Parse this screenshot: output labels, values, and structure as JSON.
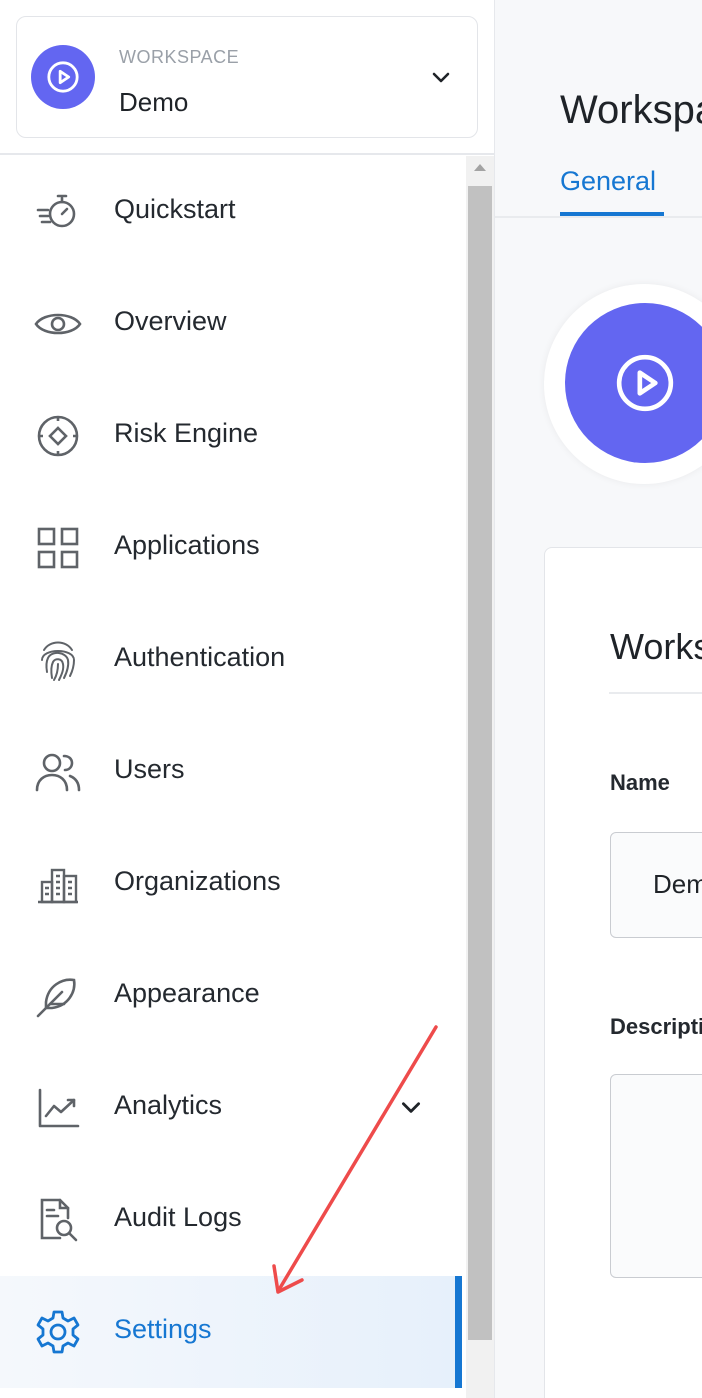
{
  "workspace": {
    "caption": "WORKSPACE",
    "name": "Demo"
  },
  "nav": {
    "items": [
      {
        "label": "Quickstart",
        "icon": "stopwatch-icon"
      },
      {
        "label": "Overview",
        "icon": "eye-icon"
      },
      {
        "label": "Risk Engine",
        "icon": "target-icon"
      },
      {
        "label": "Applications",
        "icon": "grid-icon"
      },
      {
        "label": "Authentication",
        "icon": "fingerprint-icon"
      },
      {
        "label": "Users",
        "icon": "users-icon"
      },
      {
        "label": "Organizations",
        "icon": "buildings-icon"
      },
      {
        "label": "Appearance",
        "icon": "feather-icon"
      },
      {
        "label": "Analytics",
        "icon": "chart-icon"
      },
      {
        "label": "Audit Logs",
        "icon": "file-search-icon"
      },
      {
        "label": "Settings",
        "icon": "gear-icon"
      }
    ],
    "active": "Settings"
  },
  "main": {
    "title": "Workspace",
    "tabs": [
      {
        "label": "General"
      }
    ],
    "card": {
      "title": "Workspace",
      "name_label": "Name",
      "name_value": "Demo",
      "description_label": "Description"
    }
  },
  "colors": {
    "accent": "#1677d2",
    "brand": "#6366f1",
    "annotation_arrow": "#ee4b4b"
  }
}
